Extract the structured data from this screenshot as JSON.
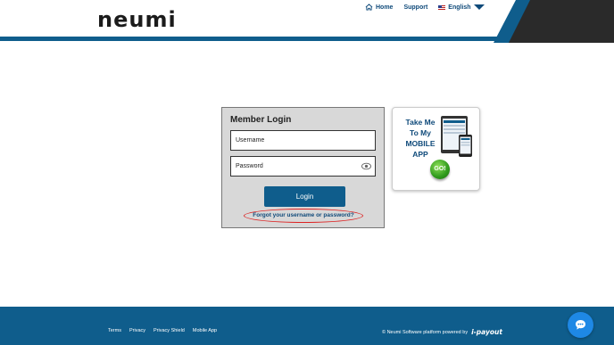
{
  "header": {
    "logo": "neumi",
    "nav": {
      "home": "Home",
      "support": "Support",
      "language": "English"
    },
    "colors": {
      "primary": "#0f5d8c",
      "dark": "#2a2a2a"
    }
  },
  "login": {
    "title": "Member Login",
    "username_placeholder": "Username",
    "password_placeholder": "Password",
    "login_button": "Login",
    "forgot_link": "Forgot your username or password?"
  },
  "app_promo": {
    "text_line1": "Take Me",
    "text_line2": "To My",
    "text_line3": "MOBILE",
    "text_line4": "APP",
    "go_label": "GO!"
  },
  "footer": {
    "links": [
      "Terms",
      "Privacy",
      "Privacy Shield",
      "Mobile App"
    ],
    "powered_text": "© Neumi Software platform powered by",
    "brand": "i-payout"
  },
  "icons": {
    "home": "home-icon",
    "flag": "us-flag-icon",
    "dropdown": "chevron-down-icon",
    "eye": "eye-icon",
    "chat": "chat-icon"
  }
}
